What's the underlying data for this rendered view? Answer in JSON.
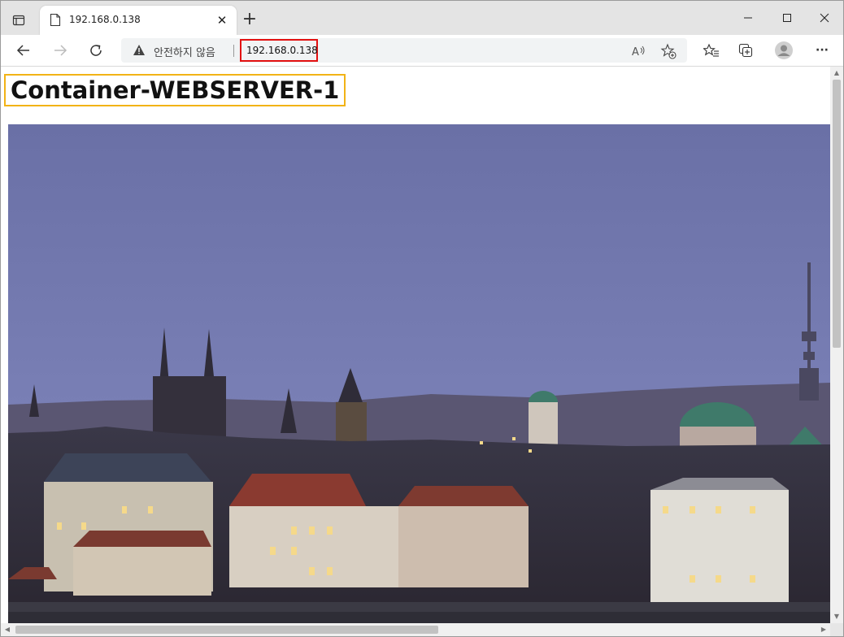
{
  "browser": {
    "tab": {
      "title": "192.168.0.138",
      "close_glyph": "✕"
    },
    "new_tab_glyph": "+",
    "window_controls": {
      "minimize": "—",
      "maximize": "☐",
      "close": "✕"
    },
    "toolbar": {
      "security_label": "안전하지 않음",
      "url": "192.168.0.138",
      "more_glyph": "···"
    },
    "icons": [
      "tab-actions-icon",
      "page-icon",
      "back-arrow-icon",
      "forward-arrow-icon",
      "refresh-icon",
      "warning-icon",
      "read-aloud-icon",
      "add-favorite-icon",
      "favorites-icon",
      "collections-icon",
      "profile-icon",
      "more-icon"
    ]
  },
  "page": {
    "heading": "Container-WEBSERVER-1",
    "image": {
      "description_icon": "city-skyline-photo"
    }
  },
  "colors": {
    "url_highlight": "#e31010",
    "heading_highlight": "#f2b316",
    "sky_top": "#6b72a8",
    "sky_bottom": "#7c84b8"
  }
}
